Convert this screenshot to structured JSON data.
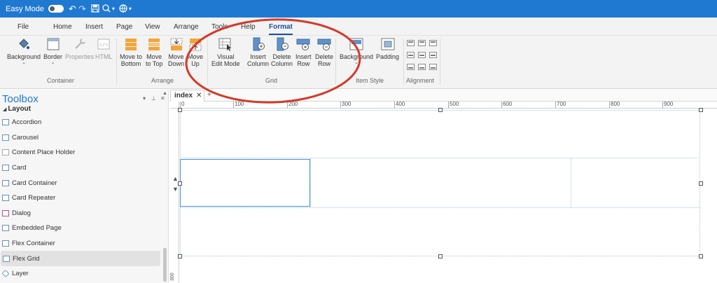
{
  "titlebar": {
    "mode_label": "Easy Mode"
  },
  "menu": {
    "tabs": [
      "File",
      "Home",
      "Insert",
      "Page",
      "View",
      "Arrange",
      "Tools",
      "Help",
      "Format"
    ],
    "active": "Format"
  },
  "ribbon": {
    "container": {
      "background": "Background",
      "border": "Border",
      "properties": "Properties",
      "html": "HTML",
      "label": "Container"
    },
    "arrange": {
      "move_to_bottom": "Move to\nBottom",
      "move_to_top": "Move\nto Top",
      "move_down": "Move\nDown",
      "move_up": "Move\nUp",
      "label": "Arrange"
    },
    "grid": {
      "visual_edit_mode": "Visual\nEdit Mode",
      "insert_column": "Insert\nColumn",
      "delete_column": "Delete\nColumn",
      "insert_row": "Insert\nRow",
      "delete_row": "Delete\nRow",
      "label": "Grid"
    },
    "item_style": {
      "background": "Background",
      "padding": "Padding",
      "label": "Item Style"
    },
    "alignment": {
      "label": "Alignment"
    }
  },
  "toolbox": {
    "title": "Toolbox",
    "section": "Layout",
    "items": [
      "Accordion",
      "Carousel",
      "Content Place Holder",
      "Card",
      "Card Container",
      "Card Repeater",
      "Dialog",
      "Embedded Page",
      "Flex Container",
      "Flex Grid",
      "Layer"
    ],
    "selected": "Flex Grid"
  },
  "document": {
    "tab_label": "index",
    "ruler_h": [
      "0",
      "100",
      "200",
      "300",
      "400",
      "500",
      "600",
      "700",
      "800",
      "900"
    ],
    "ruler_v": [
      "300"
    ]
  },
  "colors": {
    "titlebar": "#1f79d1",
    "active_tab": "#1f4d9e",
    "annotation_circle": "#d33a2c",
    "grid_outline": "#a6c7e6"
  }
}
